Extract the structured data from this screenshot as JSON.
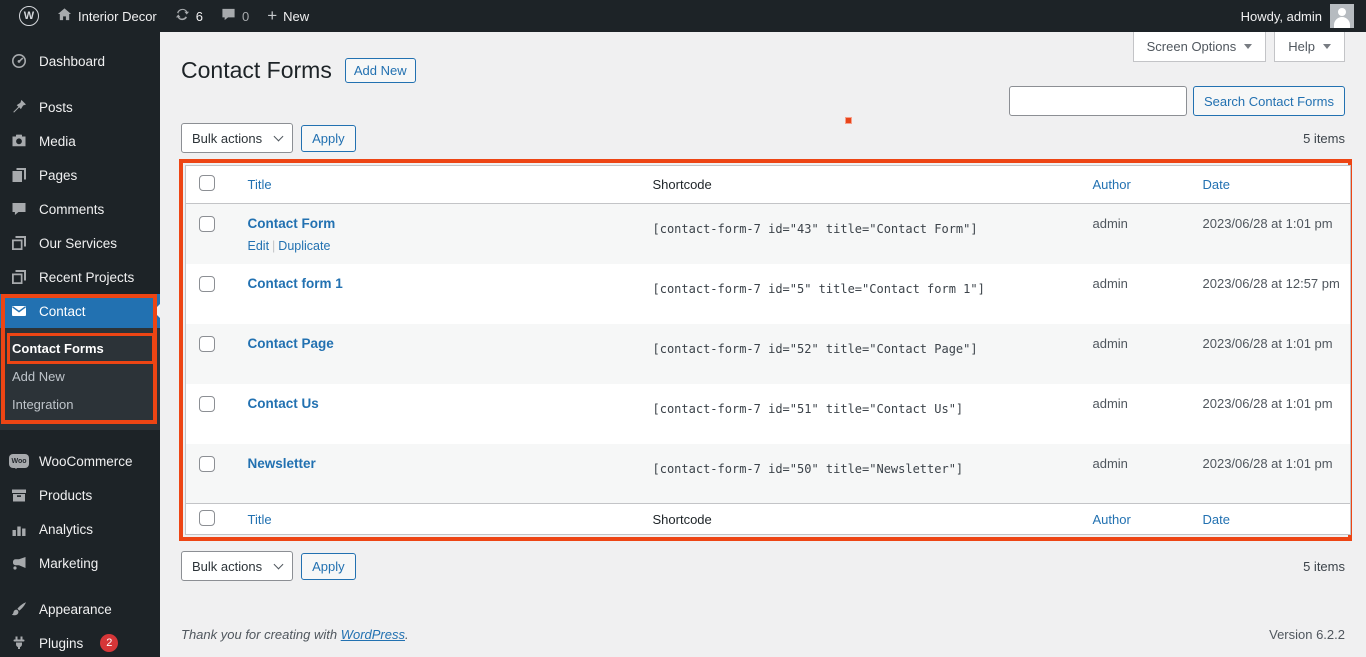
{
  "admin_bar": {
    "site_name": "Interior Decor",
    "updates_count": "6",
    "comments_count": "0",
    "new_label": "New",
    "howdy": "Howdy, admin"
  },
  "icons": {
    "wordpress_logo": "circled-W",
    "home": "house",
    "updates": "circular-arrows",
    "comments": "speech-bubble",
    "new": "plus",
    "woocommerce_logo_text": "Woo",
    "dropdown_indicator": "triangle-down"
  },
  "sidebar": {
    "items": [
      {
        "label": "Dashboard"
      },
      {
        "label": "Posts"
      },
      {
        "label": "Media"
      },
      {
        "label": "Pages"
      },
      {
        "label": "Comments"
      },
      {
        "label": "Our Services"
      },
      {
        "label": "Recent Projects"
      },
      {
        "label": "Contact"
      },
      {
        "label": "WooCommerce"
      },
      {
        "label": "Products"
      },
      {
        "label": "Analytics"
      },
      {
        "label": "Marketing"
      },
      {
        "label": "Appearance"
      },
      {
        "label": "Plugins"
      }
    ],
    "plugins_badge": "2",
    "submenu": [
      "Contact Forms",
      "Add New",
      "Integration"
    ]
  },
  "header": {
    "title": "Contact Forms",
    "add_new": "Add New",
    "screen_options": "Screen Options",
    "help": "Help",
    "search_button": "Search Contact Forms",
    "items_count": "5 items"
  },
  "toolbar": {
    "bulk_actions": "Bulk actions",
    "apply": "Apply"
  },
  "table": {
    "columns": {
      "title": "Title",
      "shortcode": "Shortcode",
      "author": "Author",
      "date": "Date"
    },
    "actions_separator": "|",
    "rows": [
      {
        "title": "Contact Form",
        "shortcode": "[contact-form-7 id=\"43\" title=\"Contact Form\"]",
        "author": "admin",
        "date": "2023/06/28 at 1:01 pm",
        "actions": {
          "edit": "Edit",
          "duplicate": "Duplicate"
        }
      },
      {
        "title": "Contact form 1",
        "shortcode": "[contact-form-7 id=\"5\" title=\"Contact form 1\"]",
        "author": "admin",
        "date": "2023/06/28 at 12:57 pm"
      },
      {
        "title": "Contact Page",
        "shortcode": "[contact-form-7 id=\"52\" title=\"Contact Page\"]",
        "author": "admin",
        "date": "2023/06/28 at 1:01 pm"
      },
      {
        "title": "Contact Us",
        "shortcode": "[contact-form-7 id=\"51\" title=\"Contact Us\"]",
        "author": "admin",
        "date": "2023/06/28 at 1:01 pm"
      },
      {
        "title": "Newsletter",
        "shortcode": "[contact-form-7 id=\"50\" title=\"Newsletter\"]",
        "author": "admin",
        "date": "2023/06/28 at 1:01 pm"
      }
    ]
  },
  "footer": {
    "thanks_prefix": "Thank you for creating with ",
    "wordpress_link": "WordPress",
    "thanks_suffix": ".",
    "version": "Version 6.2.2"
  },
  "colors": {
    "accent": "#2271b1",
    "annotation": "#ed4514",
    "badge": "#d63638",
    "admin_bar_bg": "#1d2327"
  }
}
